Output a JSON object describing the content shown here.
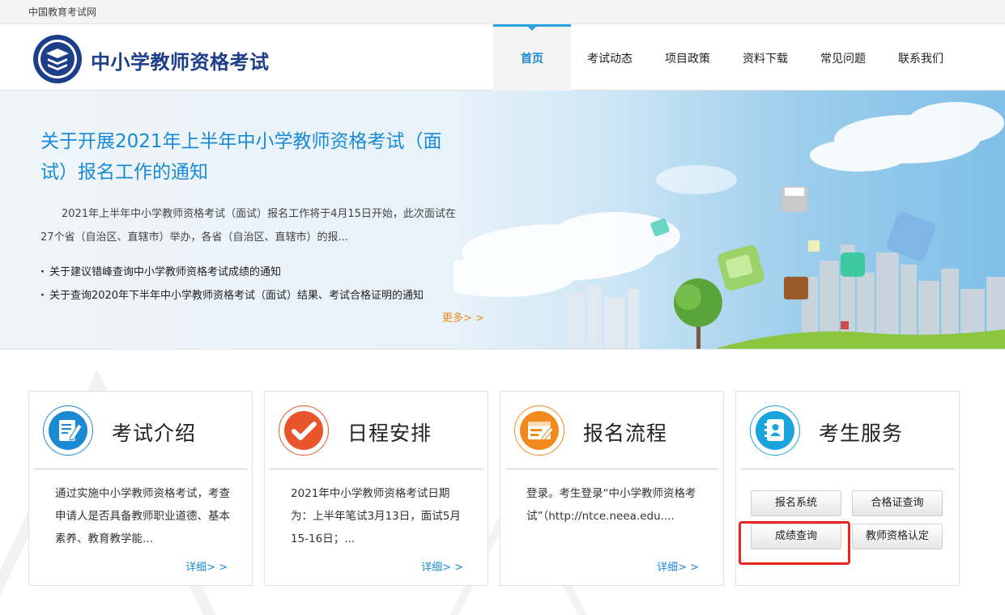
{
  "topbar": {
    "site_name": "中国教育考试网"
  },
  "header": {
    "logo_text": "中小学教师资格考试",
    "nav": [
      {
        "label": "首页",
        "active": true
      },
      {
        "label": "考试动态"
      },
      {
        "label": "项目政策"
      },
      {
        "label": "资料下载"
      },
      {
        "label": "常见问题"
      },
      {
        "label": "联系我们"
      }
    ]
  },
  "banner": {
    "title": "关于开展2021年上半年中小学教师资格考试（面试）报名工作的通知",
    "summary": "2021年上半年中小学教师资格考试（面试）报名工作将于4月15日开始，此次面试在27个省（自治区、直辖市）举办，各省（自治区、直辖市）的报...",
    "links": [
      "关于建议错峰查询中小学教师资格考试成绩的通知",
      "关于查询2020年下半年中小学教师资格考试（面试）结果、考试合格证明的通知"
    ],
    "more": "更多> >"
  },
  "cards": [
    {
      "title": "考试介绍",
      "desc": "通过实施中小学教师资格考试，考查申请人是否具备教师职业道德、基本素养、教育教学能...",
      "link": "详细> >",
      "icon": "document-edit-icon",
      "color": "#1a8ad4"
    },
    {
      "title": "日程安排",
      "desc": "2021年中小学教师资格考试日期为：上半年笔试3月13日，面试5月15-16日；...",
      "link": "详细> >",
      "icon": "checkmark-icon",
      "color": "#e8552a"
    },
    {
      "title": "报名流程",
      "desc": "登录。考生登录“中小学教师资格考试”（http://ntce.neea.edu....",
      "link": "详细> >",
      "icon": "form-window-icon",
      "color": "#f08a1c"
    },
    {
      "title": "考生服务",
      "icon": "contact-book-icon",
      "color": "#1aa4dd",
      "buttons": [
        "报名系统",
        "合格证查询",
        "成绩查询",
        "教师资格认定"
      ]
    }
  ],
  "colors": {
    "accent": "#1a8ad4",
    "more": "#f08a1c",
    "highlight": "#e8251f"
  }
}
